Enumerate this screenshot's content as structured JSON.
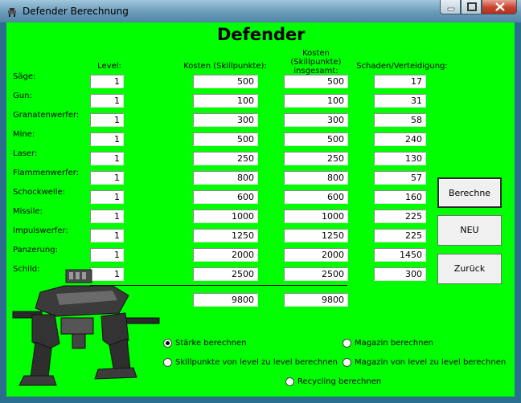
{
  "window": {
    "title": "Defender Berechnung"
  },
  "heading": "Defender",
  "columns": {
    "level": "Level:",
    "cost": "Kosten (Skillpunkte):",
    "total": "Kosten (Skillpunkte) insgesamt:",
    "damage": "Schaden/Verteidigung:"
  },
  "rows": [
    {
      "label": "Säge:",
      "level": "1",
      "cost": "500",
      "total": "500",
      "damage": "17"
    },
    {
      "label": "Gun:",
      "level": "1",
      "cost": "100",
      "total": "100",
      "damage": "31"
    },
    {
      "label": "Granatenwerfer:",
      "level": "1",
      "cost": "300",
      "total": "300",
      "damage": "58"
    },
    {
      "label": "Mine:",
      "level": "1",
      "cost": "500",
      "total": "500",
      "damage": "240"
    },
    {
      "label": "Laser:",
      "level": "1",
      "cost": "250",
      "total": "250",
      "damage": "130"
    },
    {
      "label": "Flammenwerfer:",
      "level": "1",
      "cost": "800",
      "total": "800",
      "damage": "57"
    },
    {
      "label": "Schockwelle:",
      "level": "1",
      "cost": "600",
      "total": "600",
      "damage": "160"
    },
    {
      "label": "Missile:",
      "level": "1",
      "cost": "1000",
      "total": "1000",
      "damage": "225"
    },
    {
      "label": "Impulswerfer:",
      "level": "1",
      "cost": "1250",
      "total": "1250",
      "damage": "225"
    },
    {
      "label": "Panzerung:",
      "level": "1",
      "cost": "2000",
      "total": "2000",
      "damage": "1450"
    },
    {
      "label": "Schild:",
      "level": "1",
      "cost": "2500",
      "total": "2500",
      "damage": "300"
    }
  ],
  "totals": {
    "cost": "9800",
    "total": "9800"
  },
  "buttons": {
    "calculate": "Berechne",
    "new": "NEU",
    "back": "Zurück"
  },
  "options": [
    {
      "label": "Stärke berechnen",
      "checked": true
    },
    {
      "label": "Skillpunkte von level zu level berechnen",
      "checked": false
    },
    {
      "label": "Magazin berechnen",
      "checked": false
    },
    {
      "label": "Magazin von level zu level berechnen",
      "checked": false
    },
    {
      "label": "Recycling berechnen",
      "checked": false
    }
  ],
  "colors": {
    "background": "#00ff00",
    "titlebar": "#6a9ab8",
    "close": "#c9412b"
  },
  "icons": {
    "app": "robot-icon",
    "minimize": "minimize-icon",
    "maximize": "maximize-icon",
    "close": "close-icon"
  }
}
